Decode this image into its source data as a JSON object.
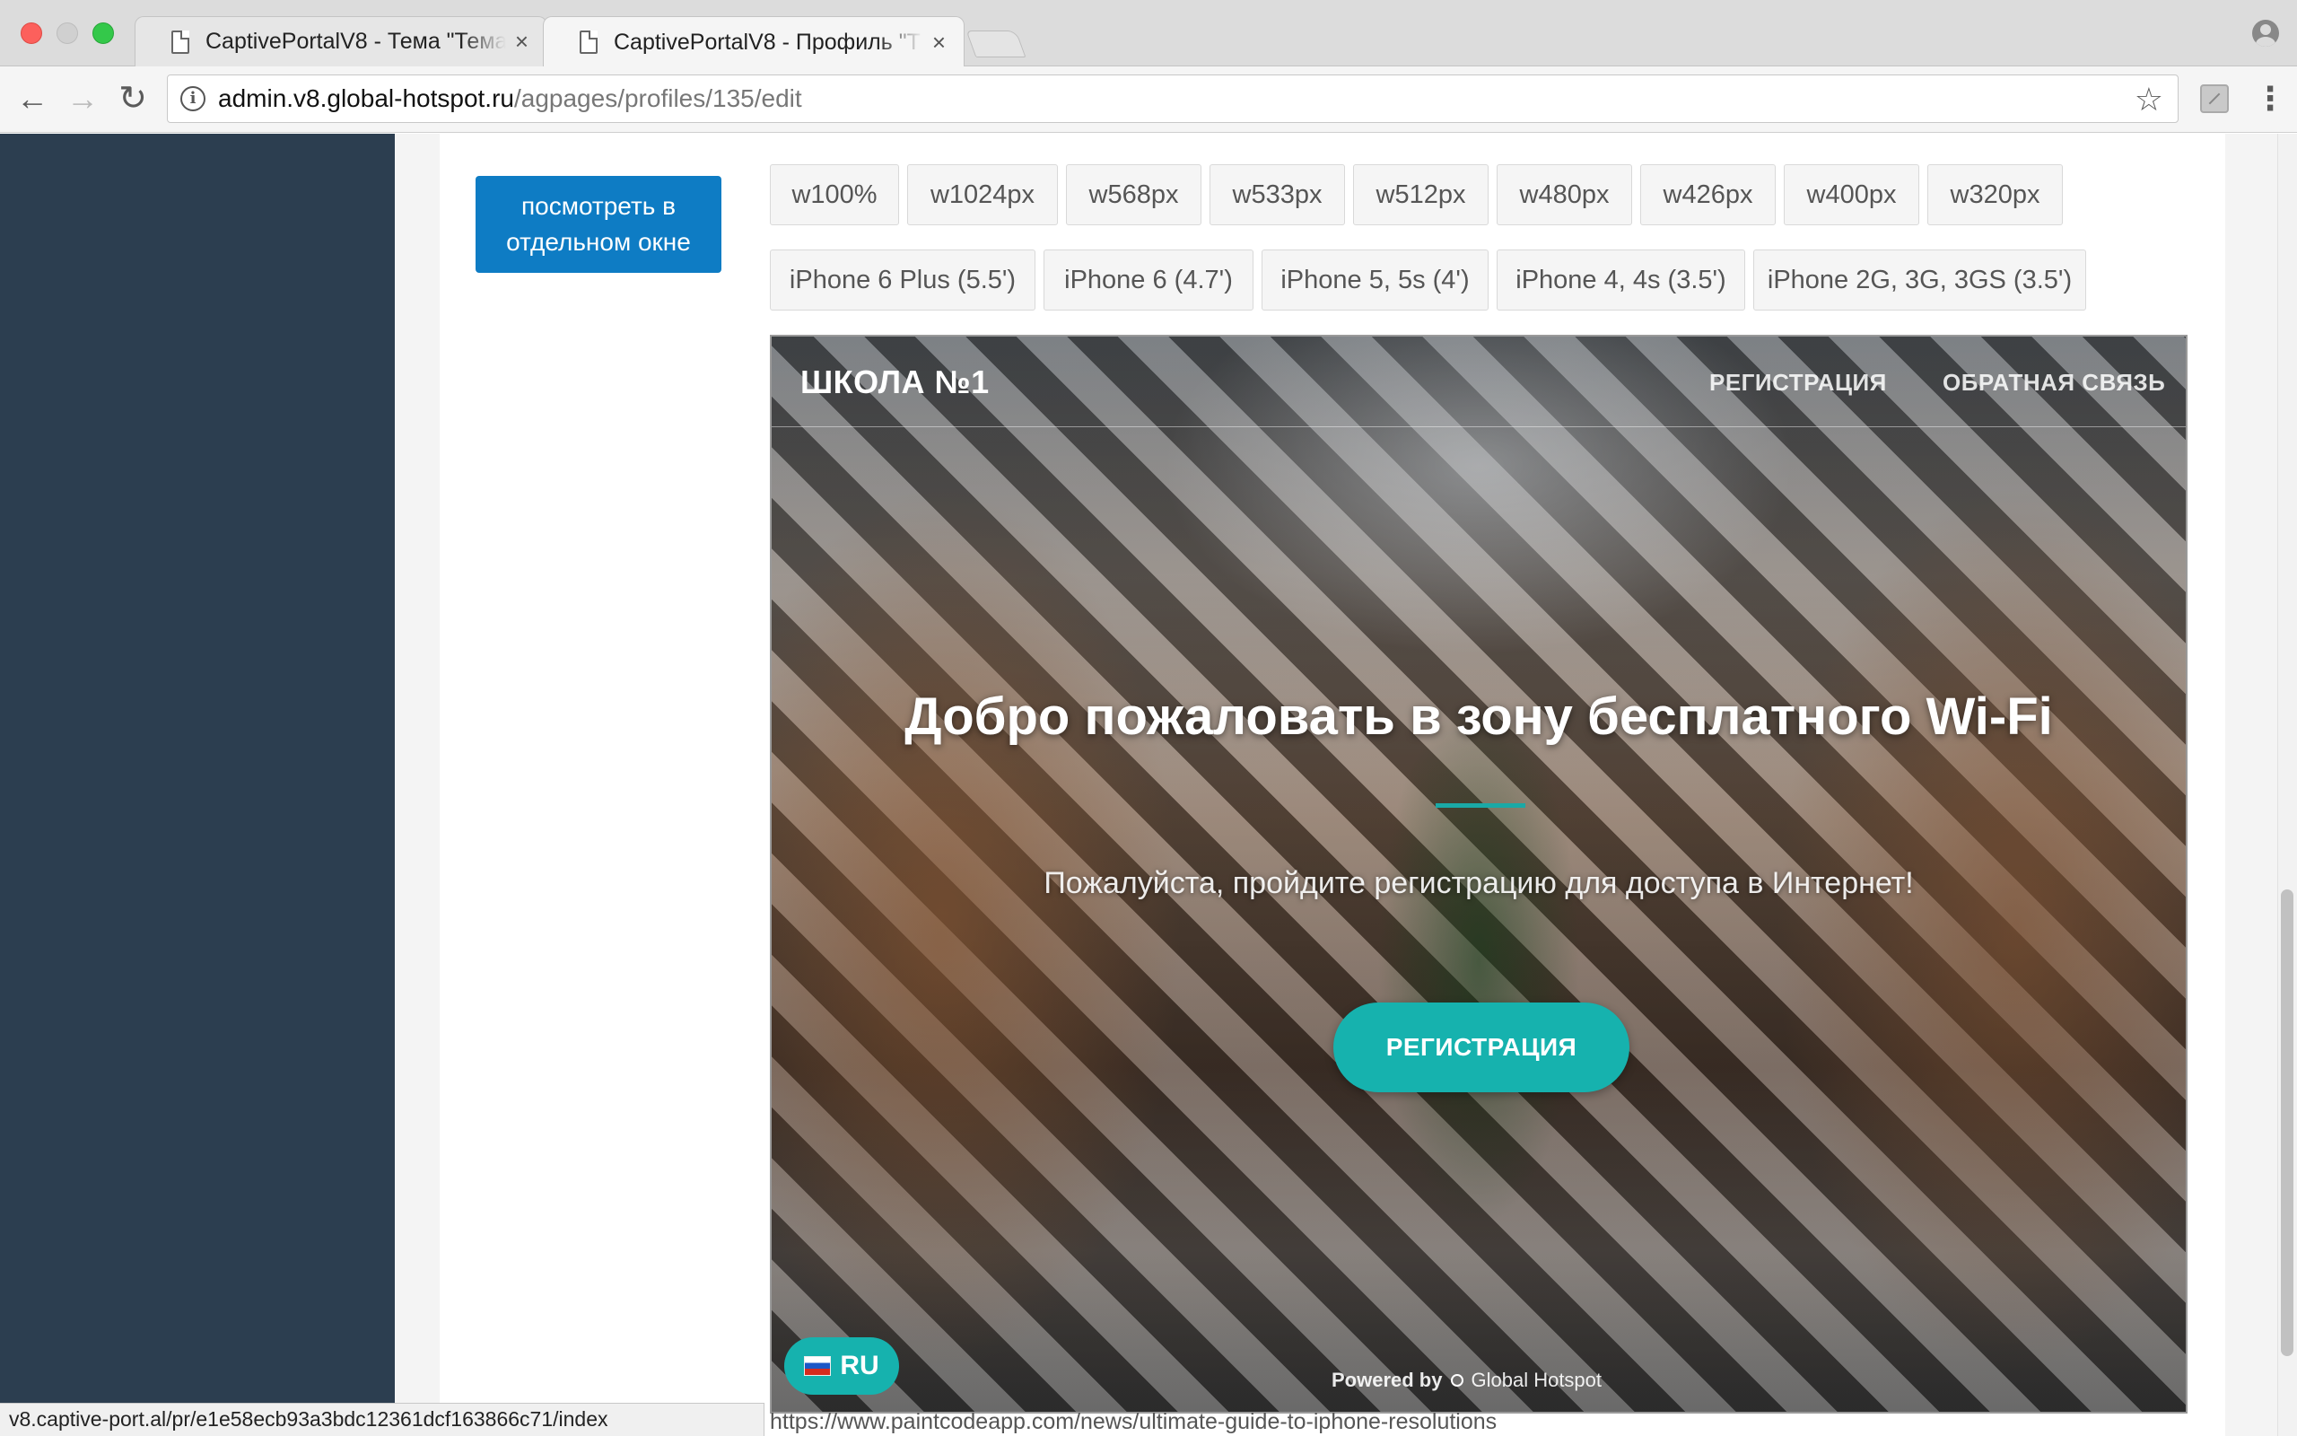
{
  "browser": {
    "tabs": [
      {
        "title": "CaptivePortalV8 - Тема \"Тема"
      },
      {
        "title": "CaptivePortalV8 - Профиль \"Т"
      }
    ],
    "close_glyph": "×",
    "url_host": "admin.v8.global-hotspot.ru",
    "url_path": "/agpages/profiles/135/edit"
  },
  "page": {
    "view_button": "посмотреть в\nотдельном окне",
    "width_buttons": [
      "w100%",
      "w1024px",
      "w568px",
      "w533px",
      "w512px",
      "w480px",
      "w426px",
      "w400px",
      "w320px"
    ],
    "device_buttons": [
      "iPhone 6 Plus (5.5')",
      "iPhone 6 (4.7')",
      "iPhone 5, 5s (4')",
      "iPhone 4, 4s (3.5')",
      "iPhone 2G, 3G, 3GS (3.5')"
    ]
  },
  "preview": {
    "brand": "ШКОЛА №1",
    "nav_register": "РЕГИСТРАЦИЯ",
    "nav_feedback": "ОБРАТНАЯ СВЯЗЬ",
    "welcome": "Добро пожаловать в зону бесплатного Wi-Fi",
    "subtitle": "Пожалуйста, пройдите регистрацию для доступа в Интернет!",
    "cta": "РЕГИСТРАЦИЯ",
    "lang": "RU",
    "powered_by": "Powered by",
    "powered_brand": "Global Hotspot",
    "accent_color": "#16b2ae"
  },
  "status": {
    "left_url": "v8.captive-port.al/pr/e1e58ecb93a3bdc12361dcf163866c71/index",
    "right_url": "https://www.paintcodeapp.com/news/ultimate-guide-to-iphone-resolutions"
  },
  "icons": {
    "back": "arrow-left-icon",
    "forward": "arrow-right-icon",
    "reload": "reload-icon",
    "info": "info-icon",
    "star": "star-icon",
    "menu": "kebab-menu-icon"
  }
}
